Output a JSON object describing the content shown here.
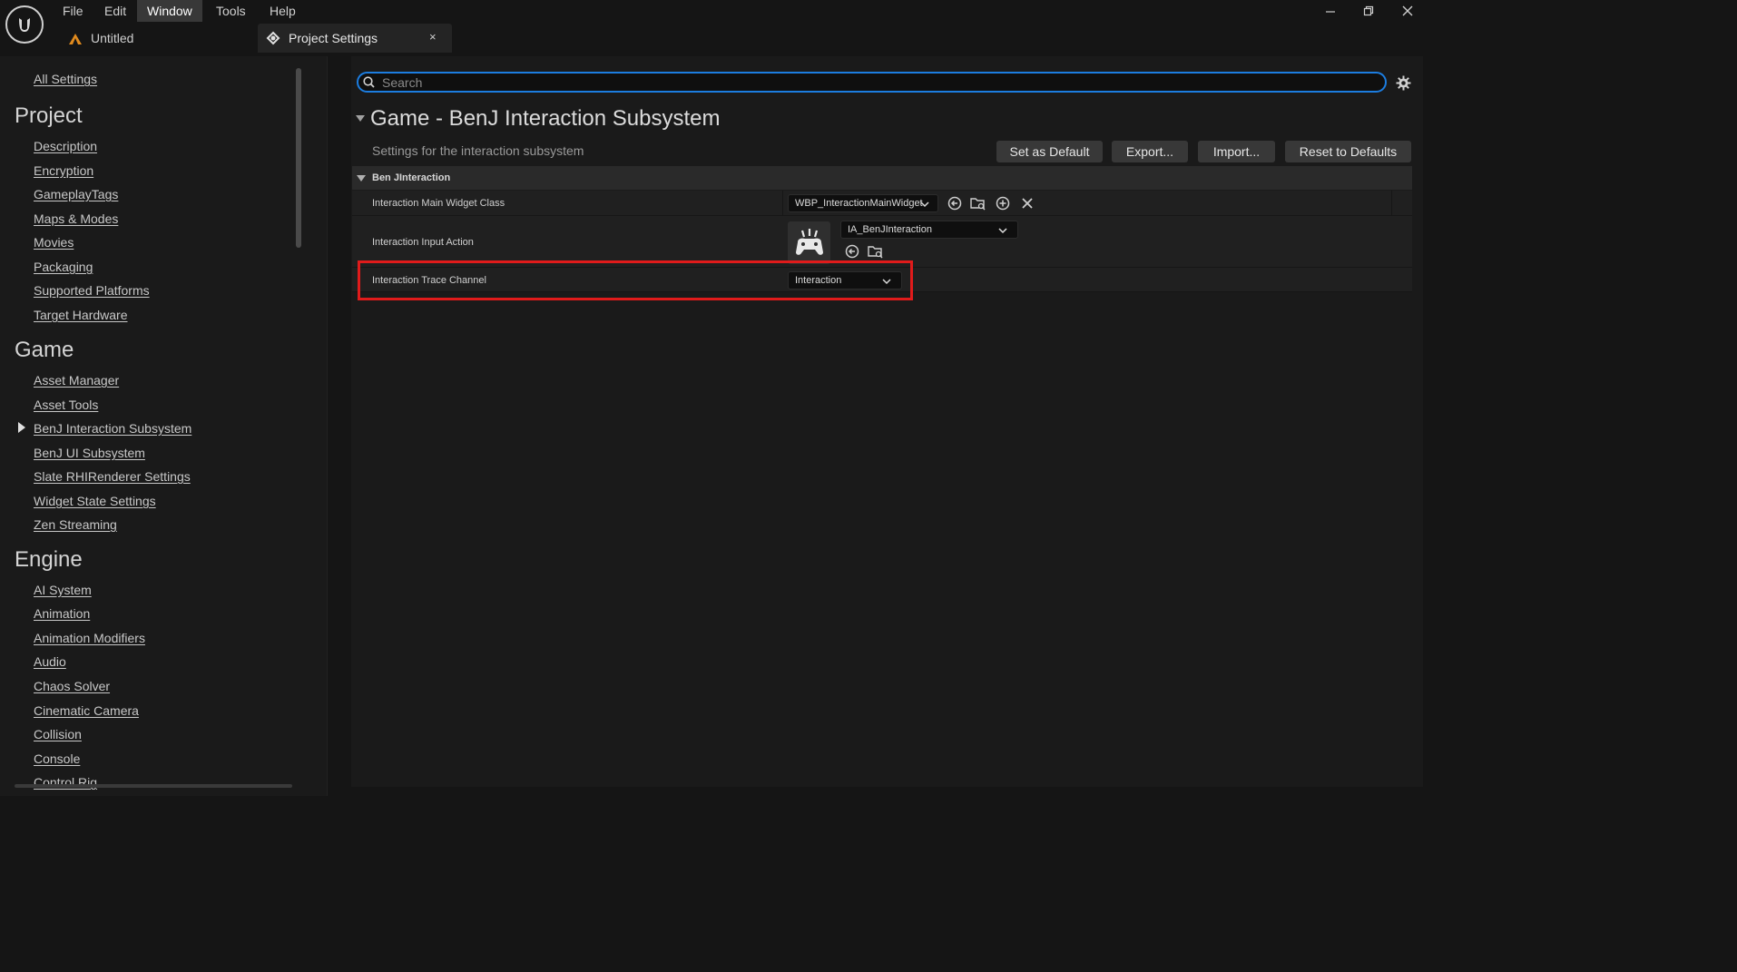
{
  "app": {
    "menu": [
      "File",
      "Edit",
      "Window",
      "Tools",
      "Help"
    ],
    "active_menu": "Window",
    "level_name": "Untitled",
    "tab_title": "Project Settings",
    "tab_close": "×"
  },
  "sidebar": {
    "all_settings": "All Settings",
    "sections": [
      {
        "heading": "Project",
        "items": [
          "Description",
          "Encryption",
          "GameplayTags",
          "Maps & Modes",
          "Movies",
          "Packaging",
          "Supported Platforms",
          "Target Hardware"
        ]
      },
      {
        "heading": "Game",
        "items": [
          "Asset Manager",
          "Asset Tools",
          "BenJ Interaction Subsystem",
          "BenJ UI Subsystem",
          "Slate RHIRenderer Settings",
          "Widget State Settings",
          "Zen Streaming"
        ]
      },
      {
        "heading": "Engine",
        "items": [
          "AI System",
          "Animation",
          "Animation Modifiers",
          "Audio",
          "Chaos Solver",
          "Cinematic Camera",
          "Collision",
          "Console",
          "Control Rig"
        ]
      }
    ],
    "selected_item": "BenJ Interaction Subsystem"
  },
  "search": {
    "placeholder": "Search",
    "value": ""
  },
  "section": {
    "title": "Game - BenJ Interaction Subsystem",
    "description": "Settings for the interaction subsystem"
  },
  "header_buttons": {
    "set_default": "Set as Default",
    "export": "Export...",
    "import": "Import...",
    "reset": "Reset to Defaults"
  },
  "category": {
    "label": "Ben JInteraction"
  },
  "properties": {
    "main_widget": {
      "label": "Interaction Main Widget Class",
      "value": "WBP_InteractionMainWidget"
    },
    "input_action": {
      "label": "Interaction Input Action",
      "value": "IA_BenJInteraction"
    },
    "trace_channel": {
      "label": "Interaction Trace Channel",
      "value": "Interaction"
    }
  },
  "colors": {
    "highlight": "#e01b1b",
    "search_border": "#1c7de0",
    "background": "#151515"
  }
}
